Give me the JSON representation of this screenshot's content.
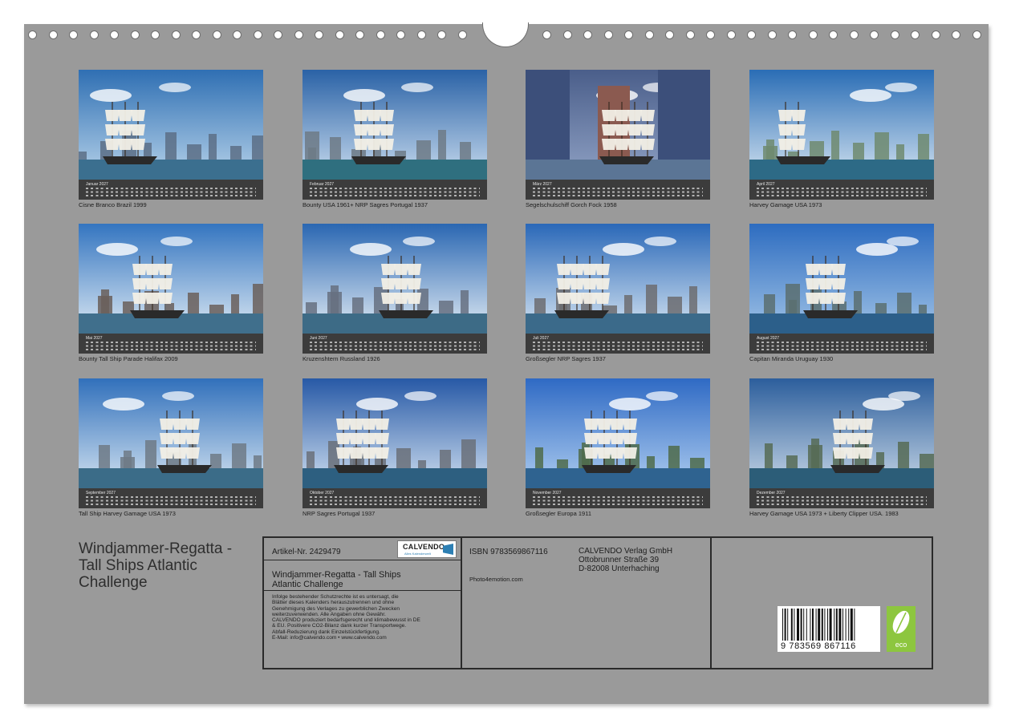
{
  "calendar": {
    "months": [
      {
        "name": "Januar 2027",
        "caption": "Cisne Branco Brazil 1999"
      },
      {
        "name": "Februar 2027",
        "caption": "Bounty USA 1961+ NRP Sagres Portugal 1937"
      },
      {
        "name": "März 2027",
        "caption": "Segelschulschiff Gorch Fock 1958"
      },
      {
        "name": "April 2027",
        "caption": "Harvey Gamage USA 1973"
      },
      {
        "name": "Mai 2027",
        "caption": "Bounty Tall Ship Parade Halifax 2009"
      },
      {
        "name": "Juni 2027",
        "caption": "Kruzenshtern Russland 1926"
      },
      {
        "name": "Juli 2027",
        "caption": "Großsegler NRP Sagres 1937"
      },
      {
        "name": "August 2027",
        "caption": "Capitan Miranda Uruguay 1930"
      },
      {
        "name": "September 2027",
        "caption": "Tall Ship Harvey Gamage USA 1973"
      },
      {
        "name": "Oktober 2027",
        "caption": "NRP Sagres Portugal 1937"
      },
      {
        "name": "November 2027",
        "caption": "Großsegler Europa 1911"
      },
      {
        "name": "Dezember 2027",
        "caption": "Harvey Gamage USA 1973 + Liberty Clipper USA. 1983"
      }
    ]
  },
  "back": {
    "title_lines": [
      "Windjammer-Regatta -",
      "Tall Ships Atlantic",
      "Challenge"
    ],
    "article": "Artikel-Nr. 2429479",
    "logo_text": "CALVENDO",
    "logo_sub": "Alles Kalenderwelt",
    "product_title_lines": [
      "Windjammer-Regatta - Tall Ships",
      "Atlantic Challenge"
    ],
    "legal_text": "Infolge bestehender Schutzrechte ist es untersagt, die\nBlätter dieses Kalenders herauszutrennen und ohne\nGenehmigung des Verlages zu gewerblichen Zwecken\nweiterzuverwenden. Alle Angaben ohne Gewähr.\nCALVENDO produziert bedarfsgerecht und klimabewusst in DE\n& EU. Positivere CO2-Bilanz dank kurzer Transportwege.\nAbfall-Reduzierung dank Einzelstückfertigung.\nE-Mail: info@calvendo.com • www.calvendo.com",
    "isbn": "ISBN 9783569867116",
    "author": "Photo4emotion.com",
    "publisher_lines": [
      "CALVENDO Verlag GmbH",
      "Ottobrunner Straße 39",
      "D-82008 Unterhaching"
    ],
    "barcode_number": "9 783569 867116",
    "eco_label": "eco"
  },
  "colors": {
    "page_background": "#9a9a9a",
    "calendar_strip": "#3c3c3c",
    "eco_badge": "#8dc63f"
  }
}
